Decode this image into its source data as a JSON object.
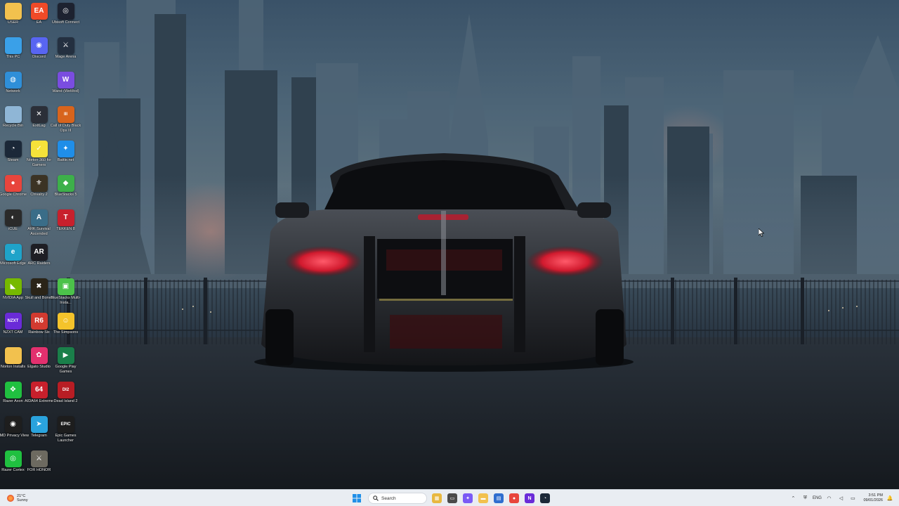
{
  "desktop": {
    "icons": [
      {
        "label": "USER",
        "icon": "folder-icon",
        "color": "#f2c14e",
        "glyph": ""
      },
      {
        "label": "EA",
        "icon": "ea-logo-icon",
        "color": "#f04a28",
        "glyph": "EA"
      },
      {
        "label": "Ubisoft Connect",
        "icon": "ubisoft-logo-icon",
        "color": "#1d2230",
        "glyph": "◎"
      },
      {
        "label": "This PC",
        "icon": "computer-icon",
        "color": "#3aa0e8",
        "glyph": ""
      },
      {
        "label": "Discord",
        "icon": "discord-logo-icon",
        "color": "#5865f2",
        "glyph": "◉"
      },
      {
        "label": "Mage Arena",
        "icon": "mage-arena-icon",
        "color": "#243040",
        "glyph": "⚔"
      },
      {
        "label": "Network",
        "icon": "network-globe-icon",
        "color": "#2f8fd8",
        "glyph": "◍"
      },
      {
        "label": "Wand (WeMod)",
        "icon": "wand-logo-icon",
        "color": "#7a4de0",
        "glyph": "W"
      },
      {
        "label": "Recycle Bin",
        "icon": "recycle-bin-icon",
        "color": "#8fb6d6",
        "glyph": ""
      },
      {
        "label": "ExitLag",
        "icon": "exitlag-logo-icon",
        "color": "#2b2f38",
        "glyph": "✕"
      },
      {
        "label": "Call of Duty Black Ops III",
        "icon": "call-of-duty-icon",
        "color": "#d8641c",
        "glyph": "III"
      },
      {
        "label": "Steam",
        "icon": "steam-logo-icon",
        "color": "#1b2838",
        "glyph": "◔"
      },
      {
        "label": "Norton 360 for Gamers",
        "icon": "norton-logo-icon",
        "color": "#f5e23a",
        "glyph": "✓"
      },
      {
        "label": "Battle.net",
        "icon": "battlenet-logo-icon",
        "color": "#1f8ee8",
        "glyph": "✦"
      },
      {
        "label": "Google Chrome",
        "icon": "chrome-logo-icon",
        "color": "#e8453c",
        "glyph": "●"
      },
      {
        "label": "Chivalry 2",
        "icon": "chivalry-2-icon",
        "color": "#3b3324",
        "glyph": "⚜"
      },
      {
        "label": "BlueStacks 5",
        "icon": "bluestacks-logo-icon",
        "color": "#3db04a",
        "glyph": "◆"
      },
      {
        "label": "iCUE",
        "icon": "icue-logo-icon",
        "color": "#2a2a2a",
        "glyph": "◐"
      },
      {
        "label": "ARK Survival Ascended",
        "icon": "ark-survival-icon",
        "color": "#3a6d88",
        "glyph": "A"
      },
      {
        "label": "TEKKEN 8",
        "icon": "tekken-8-icon",
        "color": "#c8202c",
        "glyph": "T"
      },
      {
        "label": "Microsoft Edge",
        "icon": "edge-logo-icon",
        "color": "#1fa3c9",
        "glyph": "e"
      },
      {
        "label": "ARC Raiders",
        "icon": "arc-raiders-icon",
        "color": "#1e1e24",
        "glyph": "AR"
      },
      {
        "label": "NVIDIA App",
        "icon": "nvidia-logo-icon",
        "color": "#76b900",
        "glyph": "◣"
      },
      {
        "label": "Skull and Bones",
        "icon": "skull-and-bones-icon",
        "color": "#2a2418",
        "glyph": "✖"
      },
      {
        "label": "BlueStacks Multi-Insta...",
        "icon": "bluestacks-multi-icon",
        "color": "#4cc24a",
        "glyph": "▣"
      },
      {
        "label": "NZXT CAM",
        "icon": "nzxt-logo-icon",
        "color": "#6a2bd8",
        "glyph": "NZXT"
      },
      {
        "label": "Rainbow Six",
        "icon": "rainbow-six-icon",
        "color": "#d23a30",
        "glyph": "R6"
      },
      {
        "label": "The Simpsons",
        "icon": "simpsons-icon",
        "color": "#f4c32b",
        "glyph": "☺"
      },
      {
        "label": "Norton Installs",
        "icon": "folder-icon",
        "color": "#f2c14e",
        "glyph": ""
      },
      {
        "label": "Elgato Studio",
        "icon": "elgato-logo-icon",
        "color": "#e3306e",
        "glyph": "✿"
      },
      {
        "label": "Google Play Games",
        "icon": "google-play-games-icon",
        "color": "#1a7f4a",
        "glyph": "▶"
      },
      {
        "label": "Razer Axon",
        "icon": "razer-axon-icon",
        "color": "#20c040",
        "glyph": "✥"
      },
      {
        "label": "AIDA64 Extreme",
        "icon": "aida64-logo-icon",
        "color": "#c8202c",
        "glyph": "64"
      },
      {
        "label": "Dead Island 2",
        "icon": "dead-island-2-icon",
        "color": "#b81d24",
        "glyph": "DI2"
      },
      {
        "label": "AMD Privacy View",
        "icon": "amd-privacy-icon",
        "color": "#1e1e1e",
        "glyph": "◉"
      },
      {
        "label": "Telegram",
        "icon": "telegram-logo-icon",
        "color": "#2aa3dd",
        "glyph": "➤"
      },
      {
        "label": "Epic Games Launcher",
        "icon": "epic-games-logo-icon",
        "color": "#1d1d1d",
        "glyph": "EPIC"
      },
      {
        "label": "Razer Cortex",
        "icon": "razer-cortex-icon",
        "color": "#20c040",
        "glyph": "◎"
      },
      {
        "label": "FOR HONOR",
        "icon": "for-honor-icon",
        "color": "#6d6a60",
        "glyph": "⚔"
      }
    ]
  },
  "taskbar": {
    "weather": {
      "temp": "21°C",
      "condition": "Sunny"
    },
    "search_placeholder": "Search",
    "apps": [
      {
        "name": "file-explorer-pinned-icon",
        "color": "#e8b840",
        "glyph": "▦"
      },
      {
        "name": "task-view-icon",
        "color": "#4a4a4a",
        "glyph": "▭"
      },
      {
        "name": "copilot-icon",
        "color": "#7a5af5",
        "glyph": "✦"
      },
      {
        "name": "file-explorer-icon",
        "color": "#f2c14e",
        "glyph": "▬"
      },
      {
        "name": "store-icon",
        "color": "#2f6ecf",
        "glyph": "▤"
      },
      {
        "name": "chrome-taskbar-icon",
        "color": "#e8453c",
        "glyph": "●"
      },
      {
        "name": "nzxt-taskbar-icon",
        "color": "#6a2bd8",
        "glyph": "N"
      },
      {
        "name": "steam-taskbar-icon",
        "color": "#1b2838",
        "glyph": "◔"
      }
    ],
    "tray": {
      "language": "ENG",
      "time": "3:51 PM",
      "date": "09/01/2026"
    }
  }
}
